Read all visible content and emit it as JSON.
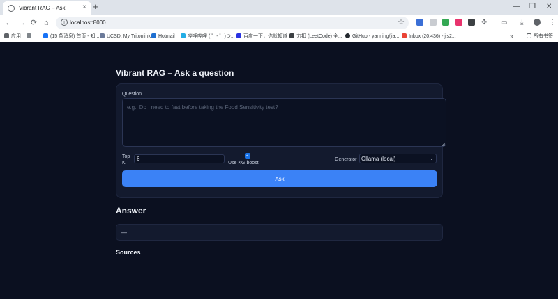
{
  "browser": {
    "tab_title": "Vibrant RAG – Ask",
    "tab_close": "×",
    "new_tab": "+",
    "window_controls": {
      "minimize": "—",
      "restore": "❐",
      "close": "✕"
    },
    "nav": {
      "back": "←",
      "forward": "→",
      "reload": "⟳",
      "home": "⌂"
    },
    "url": "localhost:8000",
    "bookmarks": [
      {
        "label": "应用",
        "icon": "apps-grid-icon"
      },
      {
        "label": "(15 条消息) 首页 - 知...",
        "icon": "zhihu-icon"
      },
      {
        "label": "UCSD: My Tritonlink",
        "icon": "ucsd-icon"
      },
      {
        "label": "Hotmail",
        "icon": "hotmail-icon"
      },
      {
        "label": "哔哩哔哩 ( ゜- ゜)つ...",
        "icon": "bilibili-icon"
      },
      {
        "label": "百度一下，你就知道",
        "icon": "baidu-icon"
      },
      {
        "label": "力扣 (LeetCode) 全...",
        "icon": "leetcode-icon"
      },
      {
        "label": "GitHub - yanning/jia...",
        "icon": "github-icon"
      },
      {
        "label": "Inbox (20,436) - jis2...",
        "icon": "gmail-icon"
      }
    ],
    "bookmarks_overflow": "»",
    "all_bookmarks": "所有书签"
  },
  "page": {
    "title": "Vibrant RAG – Ask a question",
    "question": {
      "label": "Question",
      "placeholder": "e.g., Do I need to fast before taking the Food Sensitivity test?",
      "value": ""
    },
    "top_k": {
      "label": "Top K",
      "value": "6"
    },
    "kg_boost": {
      "label": "Use KG boost",
      "checked": true
    },
    "generator": {
      "label": "Generator",
      "selected": "Ollama (local)"
    },
    "ask_button": "Ask",
    "answer": {
      "heading": "Answer",
      "text": "—"
    },
    "sources": {
      "heading": "Sources"
    }
  },
  "colors": {
    "page_bg": "#0b1020",
    "card_bg": "#131a2e",
    "accent": "#3b82f6",
    "text": "#eef2f8"
  }
}
